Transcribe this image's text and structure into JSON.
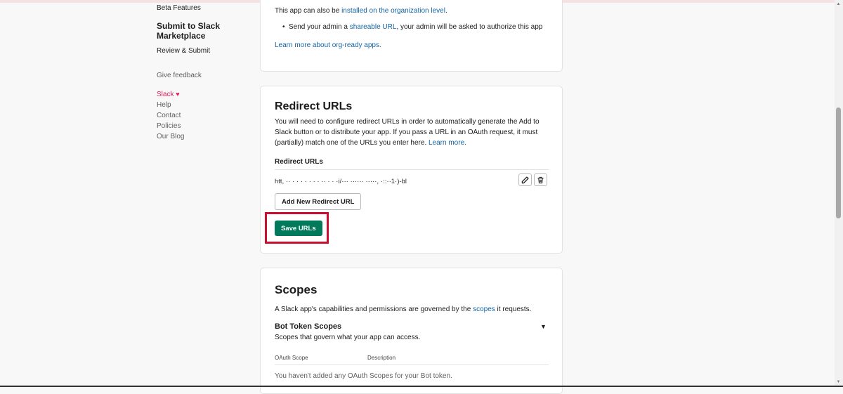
{
  "sidebar": {
    "beta_features": "Beta Features",
    "submit_heading": "Submit to Slack Marketplace",
    "review_submit": "Review & Submit",
    "give_feedback": "Give feedback",
    "slack": "Slack",
    "help": "Help",
    "contact": "Contact",
    "policies": "Policies",
    "our_blog": "Our Blog"
  },
  "org_card": {
    "line_prefix": "This app can also be ",
    "line_link": "installed on the organization level",
    "line_suffix": ".",
    "bullet_prefix": "Send your admin a ",
    "bullet_link": "shareable URL",
    "bullet_suffix": ", your admin will be asked to authorize this app",
    "learn_more": "Learn more about org-ready apps."
  },
  "redirect_card": {
    "title": "Redirect URLs",
    "description": "You will need to configure redirect URLs in order to automatically generate the Add to Slack button or to distribute your app. If you pass a URL in an OAuth request, it must (partially) match one of the URLs you enter here.",
    "learn_more": "Learn more.",
    "list_label": "Redirect URLs",
    "url_value": "htt,  ··  ·  ·    ·  ·        ·       ·  ·   ··  ·  ·   ·i/···        ······ ·····, ·::··1·)-bl",
    "add_button": "Add New Redirect URL",
    "save_button": "Save URLs"
  },
  "scopes_card": {
    "title": "Scopes",
    "desc_prefix": "A Slack app's capabilities and permissions are governed by the ",
    "desc_link": "scopes",
    "desc_suffix": " it requests.",
    "bot_heading": "Bot Token Scopes",
    "bot_desc": "Scopes that govern what your app can access.",
    "col_scope": "OAuth Scope",
    "col_desc": "Description",
    "empty": "You haven't added any OAuth Scopes for your Bot token."
  },
  "colors": {
    "primary_button": "#007a5a",
    "link": "#1264a3",
    "highlight": "#c8102e",
    "slack_pink": "#e01e5a"
  },
  "icons": {
    "edit": "pencil-icon",
    "delete": "trash-icon",
    "expand": "caret-down-icon",
    "love": "heart-icon"
  }
}
